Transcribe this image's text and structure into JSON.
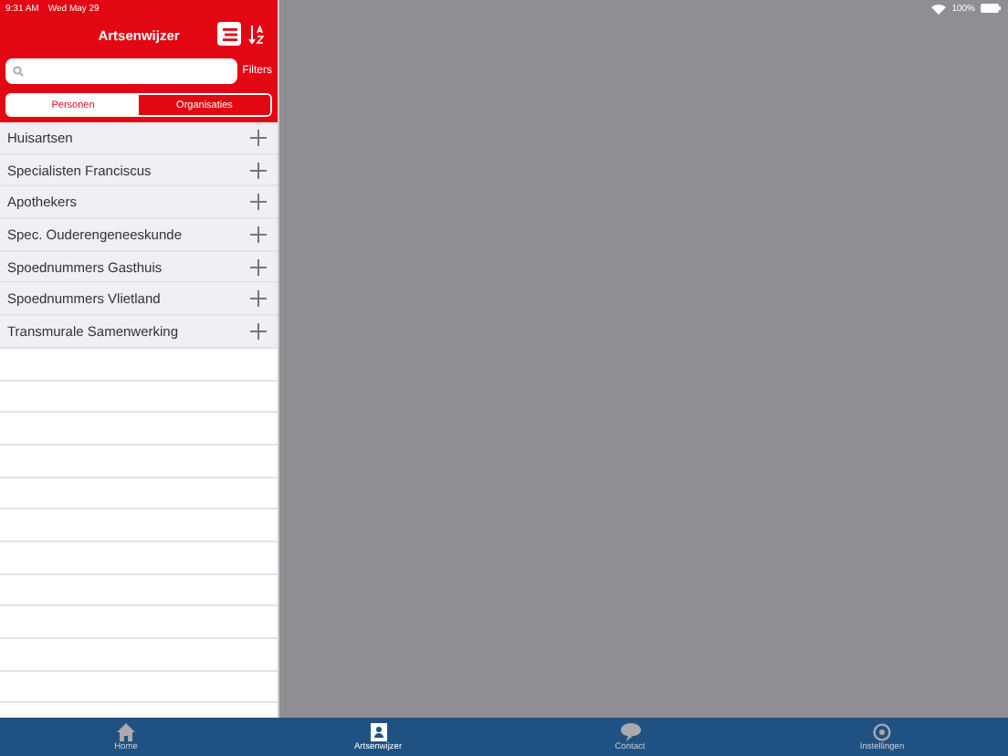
{
  "status_bar": {
    "time": "9:31 AM",
    "date": "Wed May 29",
    "battery": "100%"
  },
  "header": {
    "title": "Artsenwijzer",
    "filters": "Filters"
  },
  "segments": [
    {
      "label": "Personen",
      "selected": true
    },
    {
      "label": "Organisaties",
      "selected": false
    }
  ],
  "list": [
    "Huisartsen",
    "Specialisten Franciscus",
    "Apothekers",
    "Spec. Ouderengeneeskunde",
    "Spoednummers Gasthuis",
    "Spoednummers Vlietland",
    "Transmurale Samenwerking"
  ],
  "tab_bar": [
    {
      "label": "Home",
      "kind": "home",
      "selected": false
    },
    {
      "label": "Artsenwijzer",
      "kind": "person",
      "selected": true
    },
    {
      "label": "Contact",
      "kind": "chat",
      "selected": false
    },
    {
      "label": "Instellingen",
      "kind": "gear",
      "selected": false
    }
  ]
}
